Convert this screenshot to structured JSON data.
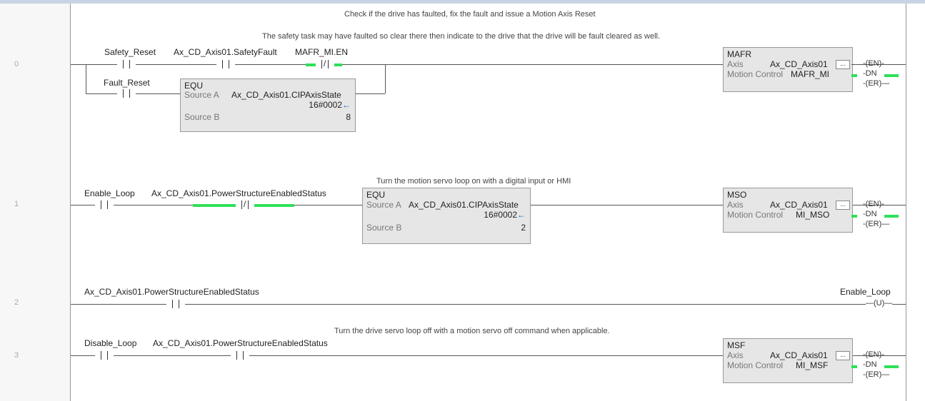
{
  "rungs": [
    {
      "number": "0",
      "comments": [
        "Check if the drive has faulted, fix the fault and issue a Motion Axis Reset",
        "The safety task may have faulted so clear there then indicate to the drive that the drive will be fault cleared as well."
      ],
      "contacts": [
        "Safety_Reset",
        "Ax_CD_Axis01.SafetyFault",
        "MAFR_MI.EN",
        "Fault_Reset"
      ],
      "equ": {
        "title": "EQU",
        "source_a_label": "Source A",
        "source_a_tag": "Ax_CD_Axis01.CIPAxisState",
        "source_a_value": "16#0002",
        "source_b_label": "Source B",
        "source_b_value": "8"
      },
      "instr": {
        "title": "MAFR",
        "axis_label": "Axis",
        "axis_value": "Ax_CD_Axis01",
        "mc_label": "Motion Control",
        "mc_value": "MAFR_MI",
        "ellipsis": "..."
      },
      "outputs": [
        "EN",
        "DN",
        "ER"
      ]
    },
    {
      "number": "1",
      "comments": [
        "Turn the motion servo loop on with a digital input or HMI"
      ],
      "contacts": [
        "Enable_Loop",
        "Ax_CD_Axis01.PowerStructureEnabledStatus"
      ],
      "equ": {
        "title": "EQU",
        "source_a_label": "Source A",
        "source_a_tag": "Ax_CD_Axis01.CIPAxisState",
        "source_a_value": "16#0002",
        "source_b_label": "Source B",
        "source_b_value": "2"
      },
      "instr": {
        "title": "MSO",
        "axis_label": "Axis",
        "axis_value": "Ax_CD_Axis01",
        "mc_label": "Motion Control",
        "mc_value": "MI_MSO",
        "ellipsis": "..."
      },
      "outputs": [
        "EN",
        "DN",
        "ER"
      ]
    },
    {
      "number": "2",
      "contacts": [
        "Ax_CD_Axis01.PowerStructureEnabledStatus"
      ],
      "coil_tag": "Enable_Loop",
      "coil_symbol": "U"
    },
    {
      "number": "3",
      "comments": [
        "Turn the drive servo loop off with a motion servo off command when applicable."
      ],
      "contacts": [
        "Disable_Loop",
        "Ax_CD_Axis01.PowerStructureEnabledStatus"
      ],
      "instr": {
        "title": "MSF",
        "axis_label": "Axis",
        "axis_value": "Ax_CD_Axis01",
        "mc_label": "Motion Control",
        "mc_value": "MI_MSF",
        "ellipsis": "..."
      },
      "outputs": [
        "EN",
        "DN",
        "ER"
      ]
    }
  ],
  "symbols": {
    "nc_slash": "/",
    "arrow": "←"
  },
  "colors": {
    "energized": "#2ee05a",
    "arrow": "#1565d8"
  }
}
